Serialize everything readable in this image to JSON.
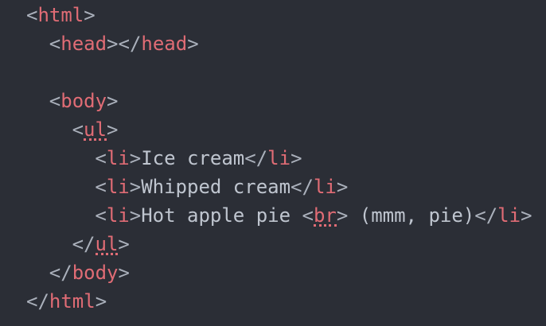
{
  "editor": {
    "lines": [
      {
        "indent": 2,
        "tokens": [
          [
            "<",
            "punct"
          ],
          [
            "html",
            "tag"
          ],
          [
            ">",
            "punct"
          ]
        ]
      },
      {
        "indent": 4,
        "tokens": [
          [
            "<",
            "punct"
          ],
          [
            "head",
            "tag"
          ],
          [
            "></",
            "punct"
          ],
          [
            "head",
            "tag"
          ],
          [
            ">",
            "punct"
          ]
        ]
      },
      {
        "indent": 0,
        "tokens": []
      },
      {
        "indent": 4,
        "tokens": [
          [
            "<",
            "punct"
          ],
          [
            "body",
            "tag"
          ],
          [
            ">",
            "punct"
          ]
        ]
      },
      {
        "indent": 6,
        "tokens": [
          [
            "<",
            "punct"
          ],
          [
            "ul",
            "tag squiggle"
          ],
          [
            ">",
            "punct"
          ]
        ]
      },
      {
        "indent": 8,
        "tokens": [
          [
            "<",
            "punct"
          ],
          [
            "li",
            "tag"
          ],
          [
            ">",
            "punct"
          ],
          [
            "Ice cream",
            "text"
          ],
          [
            "</",
            "punct"
          ],
          [
            "li",
            "tag"
          ],
          [
            ">",
            "punct"
          ]
        ]
      },
      {
        "indent": 8,
        "tokens": [
          [
            "<",
            "punct"
          ],
          [
            "li",
            "tag"
          ],
          [
            ">",
            "punct"
          ],
          [
            "Whipped cream",
            "text"
          ],
          [
            "</",
            "punct"
          ],
          [
            "li",
            "tag"
          ],
          [
            ">",
            "punct"
          ]
        ]
      },
      {
        "indent": 8,
        "tokens": [
          [
            "<",
            "punct"
          ],
          [
            "li",
            "tag"
          ],
          [
            ">",
            "punct"
          ],
          [
            "Hot apple pie ",
            "text"
          ],
          [
            "<",
            "punct"
          ],
          [
            "br",
            "tag squiggle"
          ],
          [
            ">",
            "punct"
          ],
          [
            " (mmm, pie)",
            "text"
          ],
          [
            "</",
            "punct"
          ],
          [
            "li",
            "tag"
          ],
          [
            ">",
            "punct"
          ]
        ]
      },
      {
        "indent": 6,
        "tokens": [
          [
            "</",
            "punct"
          ],
          [
            "ul",
            "tag squiggle"
          ],
          [
            ">",
            "punct"
          ]
        ]
      },
      {
        "indent": 4,
        "tokens": [
          [
            "</",
            "punct"
          ],
          [
            "body",
            "tag"
          ],
          [
            ">",
            "punct"
          ]
        ]
      },
      {
        "indent": 2,
        "tokens": [
          [
            "</",
            "punct"
          ],
          [
            "html",
            "tag"
          ],
          [
            ">",
            "punct"
          ]
        ]
      }
    ],
    "colors": {
      "background": "#2b2e36",
      "tag": "#e06c75",
      "punctuation": "#aab0bb",
      "text": "#bfc5cf",
      "lint_squiggle": "#e06c75"
    }
  }
}
